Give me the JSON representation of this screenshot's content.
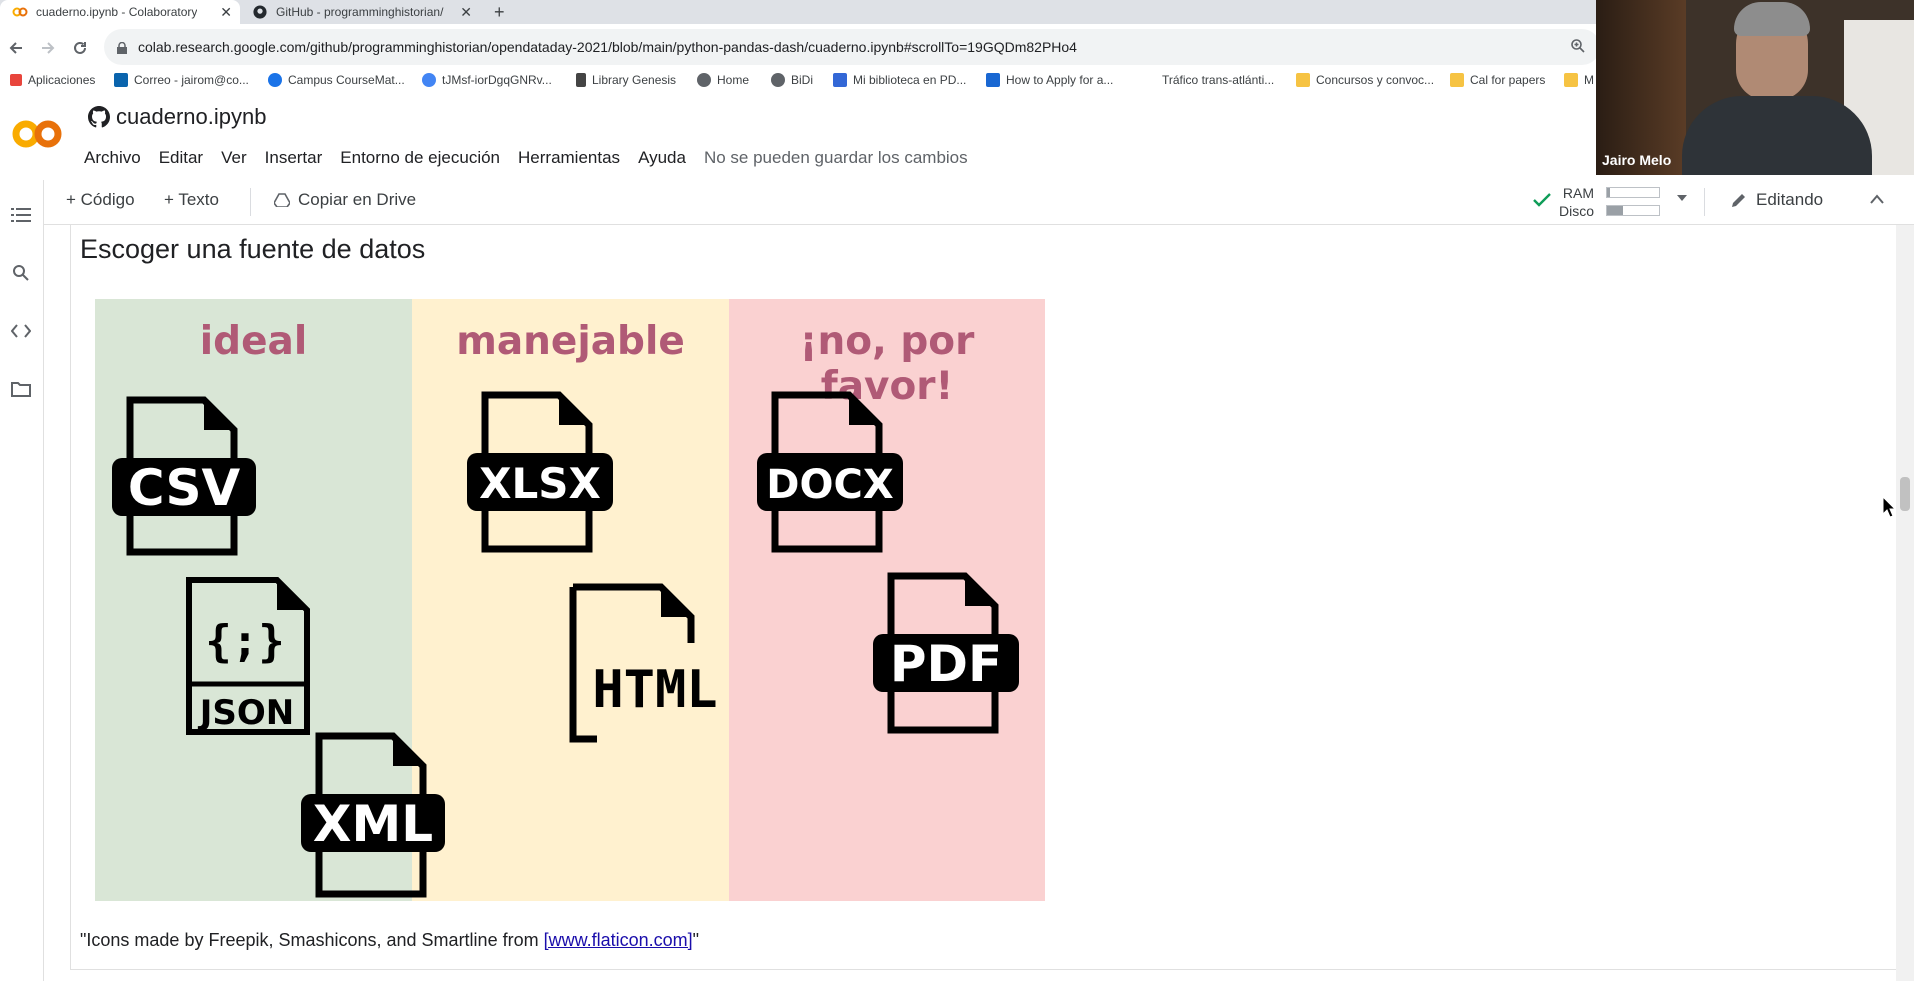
{
  "browser": {
    "tabs": [
      {
        "title": "cuaderno.ipynb - Colaboratory",
        "active": true,
        "icon": "colab-icon"
      },
      {
        "title": "GitHub - programminghistorian/",
        "active": false,
        "icon": "github-icon"
      }
    ],
    "new_tab": "+",
    "url": "colab.research.google.com/github/programminghistorian/opendataday-2021/blob/main/python-pandas-dash/cuaderno.ipynb#scrollTo=19GQDm82PHo4",
    "bookmarks": [
      {
        "label": "Aplicaciones",
        "icon": "apps-grid-icon",
        "color": "#e8453c"
      },
      {
        "label": "Correo - jairom@co...",
        "icon": "outlook-icon",
        "color": "#0a64ad"
      },
      {
        "label": "Campus CourseMat...",
        "icon": "c-icon",
        "color": "#1a73e8"
      },
      {
        "label": "tJMsf-iorDgqGNRv...",
        "icon": "video-icon",
        "color": "#4285f4"
      },
      {
        "label": "Library Genesis",
        "icon": "library-icon",
        "color": "#444444"
      },
      {
        "label": "Home",
        "icon": "globe-icon",
        "color": "#5f6368"
      },
      {
        "label": "BiDi",
        "icon": "globe-icon",
        "color": "#5f6368"
      },
      {
        "label": "Mi biblioteca en PD...",
        "icon": "pdf-drive-icon",
        "color": "#3367d6"
      },
      {
        "label": "How to Apply for a...",
        "icon": "doc-icon",
        "color": "#1967d2"
      },
      {
        "label": "Tráfico trans-atlánti...",
        "icon": "blank-icon",
        "color": "#ffffff"
      },
      {
        "label": "Concursos y convoc...",
        "icon": "folder-icon",
        "color": "#f6c343"
      },
      {
        "label": "Cal for papers",
        "icon": "folder-icon",
        "color": "#f6c343"
      },
      {
        "label": "M",
        "icon": "folder-icon",
        "color": "#f6c343"
      }
    ]
  },
  "colab": {
    "notebook_title": "cuaderno.ipynb",
    "menu": [
      "Archivo",
      "Editar",
      "Ver",
      "Insertar",
      "Entorno de ejecución",
      "Herramientas",
      "Ayuda"
    ],
    "save_status": "No se pueden guardar los cambios",
    "toolbar": {
      "add_code": "+ Código",
      "add_text": "+ Texto",
      "copy_drive": "Copiar en Drive",
      "ram_label": "RAM",
      "disk_label": "Disco",
      "ram_fraction": 0.05,
      "disk_fraction": 0.3,
      "editing": "Editando"
    }
  },
  "content": {
    "heading": "Escoger una fuente de datos",
    "columns": [
      {
        "title": "ideal",
        "bg": "#d9e6d6",
        "files": [
          "CSV",
          "JSON",
          "XML"
        ]
      },
      {
        "title": "manejable",
        "bg": "#fff1cf",
        "files": [
          "XLSX",
          "HTML"
        ]
      },
      {
        "title": "¡no, por favor!",
        "bg": "#fad1d1",
        "files": [
          "DOCX",
          "PDF"
        ]
      }
    ],
    "json_braces": "{;}",
    "caption_prefix": "\"Icons made by Freepik, Smashicons, and Smartline from ",
    "caption_link": "[www.flaticon.com]",
    "caption_suffix": "\""
  },
  "video": {
    "name": "Jairo Melo"
  }
}
